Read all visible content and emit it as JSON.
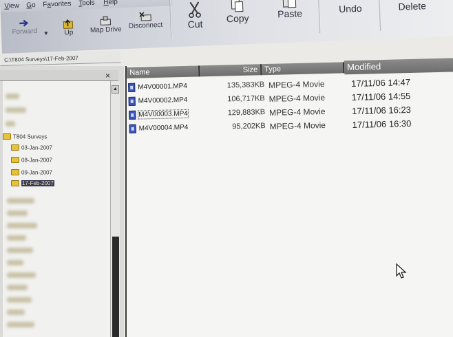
{
  "menu": [
    {
      "label": "View",
      "accel": "V"
    },
    {
      "label": "Go",
      "accel": "G"
    },
    {
      "label": "Favorites",
      "accel": "a"
    },
    {
      "label": "Tools",
      "accel": "T"
    },
    {
      "label": "Help",
      "accel": "H"
    }
  ],
  "toolbar": {
    "forward": "Forward",
    "up": "Up",
    "map_drive": "Map Drive",
    "disconnect": "Disconnect",
    "cut": "Cut",
    "copy": "Copy",
    "paste": "Paste",
    "undo": "Undo",
    "delete": "Delete"
  },
  "address": {
    "value": "C:\\T804 Surveys\\17-Feb-2007"
  },
  "folder_pane": {
    "close": "×"
  },
  "tree": {
    "root": "T804 Surveys",
    "items": [
      "03-Jan-2007",
      "08-Jan-2007",
      "09-Jan-2007",
      "17-Feb-2007"
    ],
    "selected_index": 3
  },
  "file_list": {
    "headers": {
      "name": "Name",
      "size": "Size",
      "type": "Type",
      "modified": "Modified"
    },
    "rows": [
      {
        "name": "M4V00001.MP4",
        "size": "135,383KB",
        "type": "MPEG-4 Movie",
        "modified": "17/11/06 14:47"
      },
      {
        "name": "M4V00002.MP4",
        "size": "106,717KB",
        "type": "MPEG-4 Movie",
        "modified": "17/11/06 14:55"
      },
      {
        "name": "M4V00003.MP4",
        "size": "129,883KB",
        "type": "MPEG-4 Movie",
        "modified": "17/11/06 16:23"
      },
      {
        "name": "M4V00004.MP4",
        "size": "95,202KB",
        "type": "MPEG-4 Movie",
        "modified": "17/11/06 16:30"
      }
    ],
    "focused_row": 2
  },
  "icons": {
    "forward": "arrow-right-icon",
    "up": "folder-up-icon",
    "map_drive": "map-drive-icon",
    "disconnect": "disconnect-drive-icon",
    "cut": "scissors-icon",
    "copy": "copy-icon",
    "paste": "paste-icon",
    "undo": "undo-icon",
    "delete": "delete-icon",
    "file": "mpeg4-file-icon",
    "folder": "folder-icon",
    "cursor": "mouse-pointer-icon"
  },
  "colors": {
    "selection_bg": "#3a3a52",
    "header_bg": "#7a7a7a",
    "folder_yellow": "#e6c13a",
    "file_icon_blue": "#3a55b8"
  }
}
